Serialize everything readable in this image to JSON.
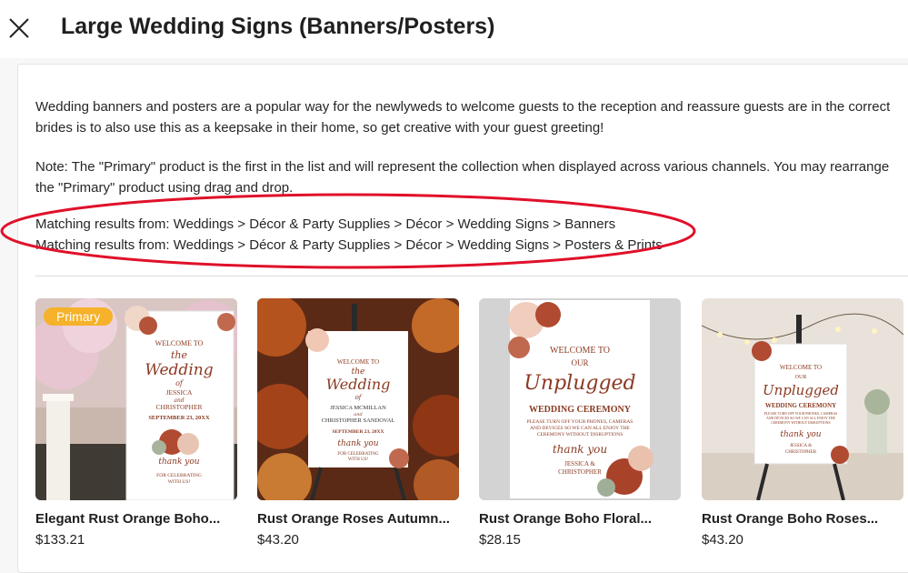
{
  "header": {
    "title": "Large Wedding Signs (Banners/Posters)",
    "close_icon": "close-icon"
  },
  "description": {
    "line1": "Wedding banners and posters are a popular way for the newlyweds to welcome guests to the reception and reassure guests are in the correct",
    "line2": "brides is to also use this as a keepsake in their home, so get creative with your guest greeting!",
    "note_line1": "Note: The \"Primary\" product is the first in the list and will represent the collection when displayed across various channels. You may rearrange",
    "note_line2": "the \"Primary\" product using drag and drop."
  },
  "matching": [
    "Matching results from: Weddings > Décor & Party Supplies > Décor > Wedding Signs > Banners",
    "Matching results from: Weddings > Décor & Party Supplies > Décor > Wedding Signs > Posters & Prints"
  ],
  "annotation_color": "#e0102a",
  "products": [
    {
      "name": "Elegant Rust Orange Boho...",
      "price": "$133.21",
      "badge": "Primary"
    },
    {
      "name": "Rust Orange Roses Autumn...",
      "price": "$43.20"
    },
    {
      "name": "Rust Orange Boho Floral...",
      "price": "$28.15"
    },
    {
      "name": "Rust Orange Boho Roses...",
      "price": "$43.20"
    }
  ],
  "sign_text": {
    "p1": {
      "welcome": "WELCOME TO",
      "the": "the",
      "wedding": "Wedding",
      "of": "of",
      "name1": "JESSICA",
      "and": "and",
      "name2": "CHRISTOPHER",
      "date": "SEPTEMBER 23, 20XX",
      "thanks": "thank you",
      "footer1": "FOR CELEBRATING",
      "footer2": "WITH US!"
    },
    "p2": {
      "welcome": "WELCOME TO",
      "the": "the",
      "wedding": "Wedding",
      "of": "of",
      "name1": "JESSICA MCMILLAN",
      "and": "and",
      "name2": "CHRISTOPHER SANDOVAL",
      "date": "SEPTEMBER 23, 20XX",
      "thanks": "thank you",
      "footer1": "FOR CELEBRATING",
      "footer2": "WITH US!"
    },
    "p3": {
      "welcome": "WELCOME TO",
      "our": "OUR",
      "unplugged": "Unplugged",
      "ceremony": "WEDDING CEREMONY",
      "line1": "PLEASE TURN OFF YOUR PHONES, CAMERAS",
      "line2": "AND DEVICES SO WE CAN ALL ENJOY THE",
      "line3": "CEREMONY WITHOUT DISRUPTIONS",
      "thanks": "thank you",
      "name1": "JESSICA &",
      "name2": "CHRISTOPHER"
    },
    "p4": {
      "welcome": "WELCOME TO",
      "our": "OUR",
      "unplugged": "Unplugged",
      "ceremony": "WEDDING CEREMONY",
      "line1": "PLEASE TURN OFF YOUR PHONES, CAMERAS",
      "line2": "AND DEVICES SO WE CAN ALL ENJOY THE",
      "line3": "CEREMONY WITHOUT DISRUPTIONS",
      "thanks": "thank you",
      "name1": "JESSICA &",
      "name2": "CHRISTOPHER"
    }
  }
}
